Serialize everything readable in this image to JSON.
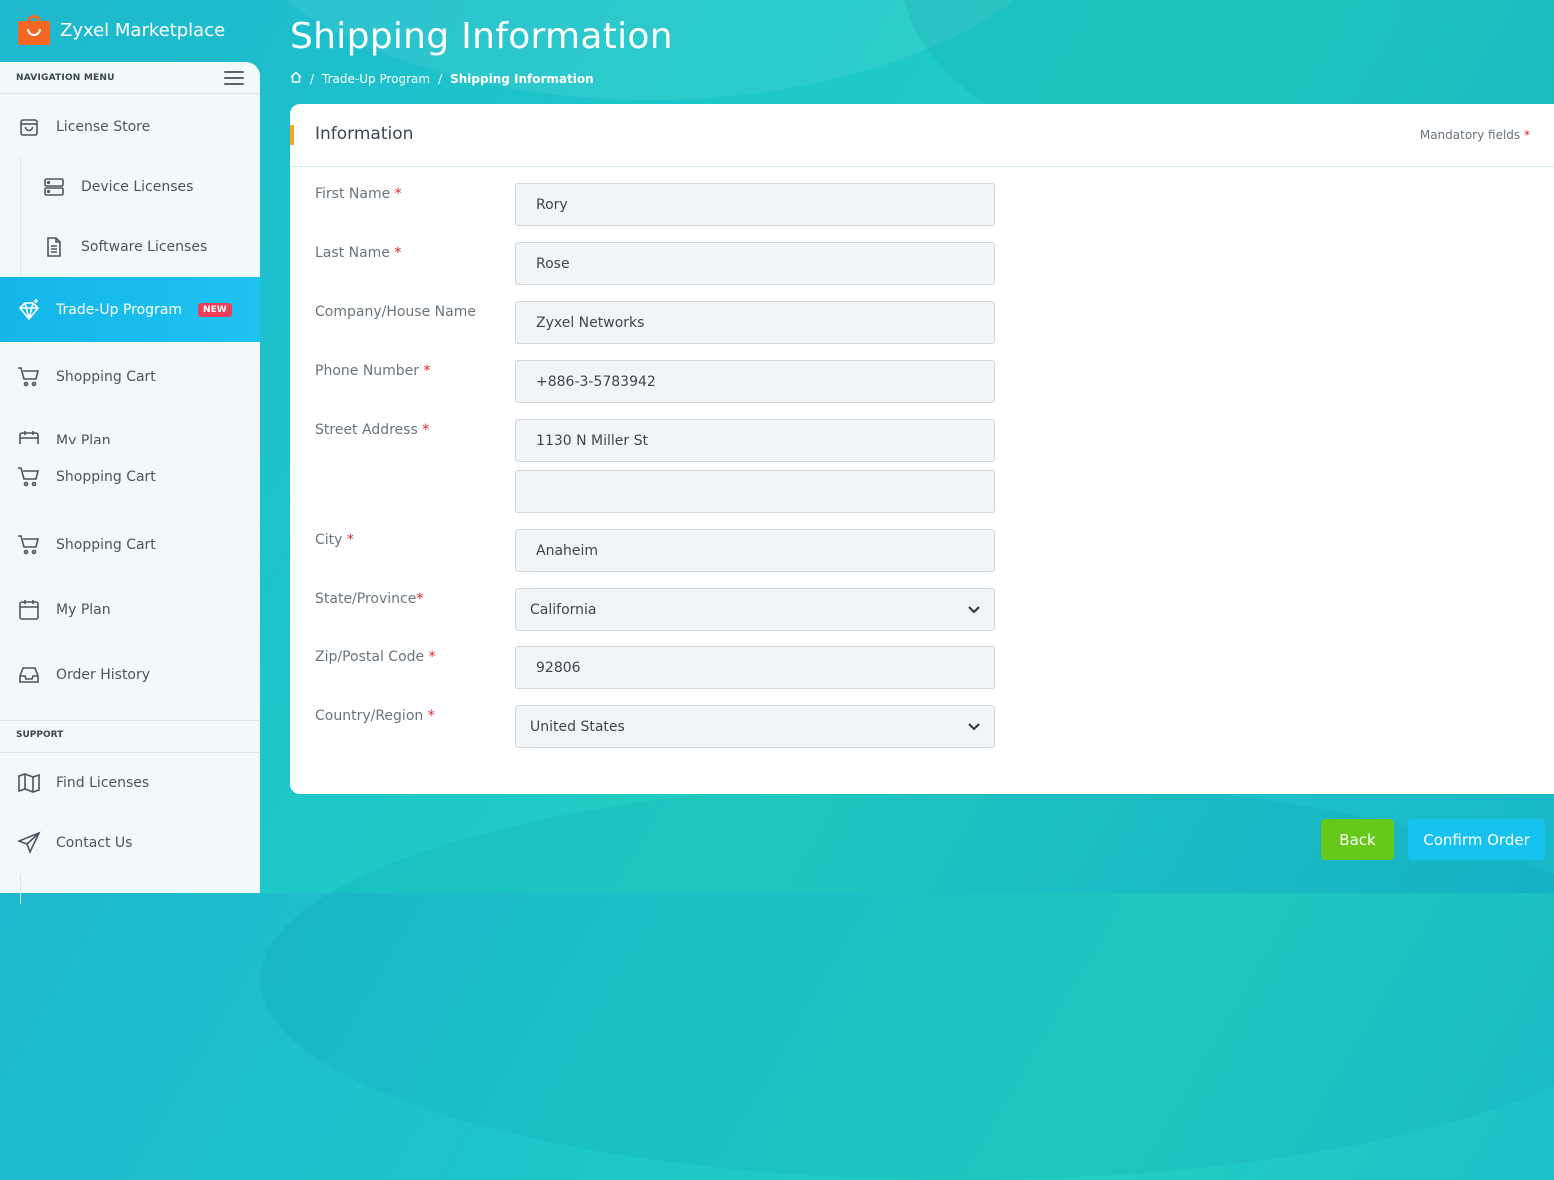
{
  "app": {
    "name": "Zyxel Marketplace"
  },
  "sidebar": {
    "nav_header": "NAVIGATION MENU",
    "items": {
      "license_store": "License Store",
      "device_licenses": "Device Licenses",
      "software_licenses": "Software Licenses",
      "trade_up": "Trade-Up Program",
      "trade_up_badge": "NEW",
      "shopping_cart_1": "Shopping Cart",
      "my_plan_clipped": "My Plan",
      "shopping_cart_2": "Shopping Cart",
      "shopping_cart_3": "Shopping Cart",
      "my_plan": "My Plan",
      "order_history": "Order History"
    },
    "support_header": "SUPPORT",
    "support_items": {
      "find_licenses": "Find Licenses",
      "contact_us": "Contact Us"
    }
  },
  "header": {
    "title": "Shipping Information",
    "breadcrumb": {
      "sep": "/",
      "program": "Trade-Up Program",
      "current": "Shipping Information"
    }
  },
  "card": {
    "title": "Information",
    "mandatory": "Mandatory fields",
    "required_mark": "*"
  },
  "form": {
    "first_name": {
      "label": "First Name",
      "value": "Rory"
    },
    "last_name": {
      "label": "Last Name",
      "value": "Rose"
    },
    "company": {
      "label": "Company/House Name",
      "value": "Zyxel Networks"
    },
    "phone": {
      "label": "Phone Number",
      "value": "+886-3-5783942"
    },
    "street": {
      "label": "Street Address",
      "value": "1130 N Miller St",
      "value2": ""
    },
    "city": {
      "label": "City",
      "value": "Anaheim"
    },
    "state": {
      "label": "State/Province",
      "value": "California"
    },
    "zip": {
      "label": "Zip/Postal Code",
      "value": "92806"
    },
    "country": {
      "label": "Country/Region",
      "value": "United States"
    }
  },
  "actions": {
    "back": "Back",
    "confirm": "Confirm Order"
  },
  "colors": {
    "accent": "#f5a623",
    "active_nav": "#13b6e8",
    "back_button": "#66c91a",
    "confirm_button": "#16c2ef",
    "required": "#e02424"
  }
}
